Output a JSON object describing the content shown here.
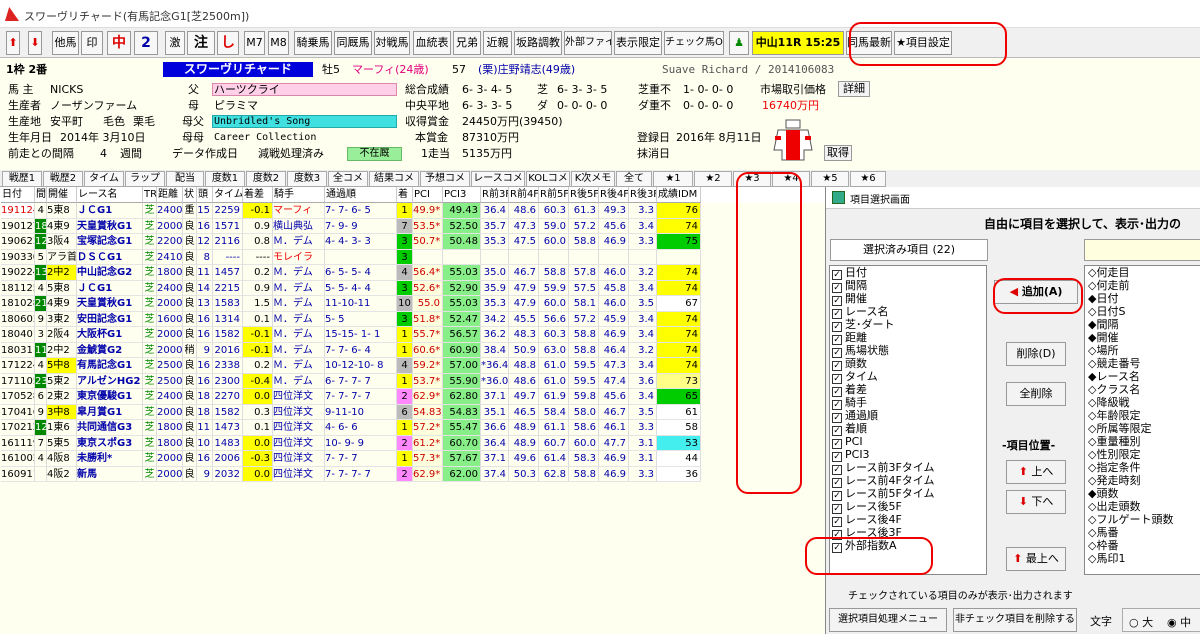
{
  "window": {
    "title": "スワーヴリチャード(有馬記念G1[芝2500m])"
  },
  "toolbar": {
    "buttons": [
      "他馬",
      "印",
      "中",
      "2",
      "激",
      "注",
      "し",
      "M7",
      "M8",
      "騎乗馬",
      "同厩馬",
      "対戦馬",
      "血統表",
      "兄弟",
      "近親",
      "坂路調教",
      "外部ファイル",
      "表示限定",
      "チェック馬OFF",
      "中山11R 15:25",
      "同馬最新",
      "★項目設定"
    ]
  },
  "horse": {
    "waku": "1枠 2番",
    "name": "スワーヴリチャード",
    "sex_age": "牡5",
    "jockey_prev": "マーフィ(24歳)",
    "weight": "57",
    "trainer": "(栗)庄野靖志(49歳)",
    "roman": "Suave Richard / 2014106083",
    "owner_label": "馬 主",
    "owner": "NICKS",
    "breeder_label": "生産者",
    "breeder": "ノーザンファーム",
    "origin_label": "生産地",
    "origin": "安平町",
    "coat_label": "毛色",
    "coat": "栗毛",
    "birth_label": "生年月日",
    "birth": "2014年 3月10日",
    "interval_label": "前走との間隔",
    "interval": "4",
    "interval_unit": "週間",
    "sire_label": "父",
    "sire": "ハーツクライ",
    "dam_label": "母",
    "dam": "ピラミマ",
    "bms_label": "母父",
    "bms": "Unbridled's Song",
    "damdam_label": "母母",
    "damdam": "Career Collection",
    "data_date_label": "データ作成日",
    "data_date": "減戦処理済み",
    "absent": "不在厩",
    "total_label": "総合成績",
    "total": "6- 3- 4- 5",
    "central_label": "中央平地",
    "central": "6- 3- 3- 5",
    "prize_label": "収得賞金",
    "prize": "24450万円(39450)",
    "main_prize_label": "本賞金",
    "main_prize": "87310万円",
    "per_race_label": "1走当",
    "per_race": "5135万円",
    "turf_label": "芝",
    "turf": "6- 3- 3- 5",
    "dirt_label": "ダ",
    "dirt": "0- 0- 0- 0",
    "turf_bad_label": "芝重不",
    "turf_bad": "1- 0- 0- 0",
    "dirt_bad_label": "ダ重不",
    "dirt_bad": "0- 0- 0- 0",
    "market_label": "市場取引価格",
    "market": "16740万円",
    "reg_label": "登録日",
    "reg": "2016年 8月11日",
    "erase_label": "抹消日",
    "detail_btn": "詳細",
    "get_btn": "取得"
  },
  "tabs": [
    "戦歴1",
    "戦歴2",
    "タイム",
    "ラップ",
    "配当",
    "度数1",
    "度数2",
    "度数3",
    "全コメ",
    "結果コメ",
    "予想コメ",
    "レースコメ",
    "KOLコメ",
    "K次メモ",
    "全て",
    "★1",
    "★2",
    "★3",
    "★4",
    "★5",
    "★6"
  ],
  "grid": {
    "headers": [
      "日付",
      "間",
      "開催",
      "レース名",
      "TR",
      "距離",
      "状",
      "頭",
      "タイム",
      "着差",
      "騎手",
      "通過順",
      "着",
      "PCI",
      "PCI3",
      "R前3F",
      "R前4F",
      "R前5F",
      "R後5F",
      "R後4F",
      "R後3F",
      "成績IDM"
    ],
    "rows": [
      [
        "191124",
        "4",
        "5東8",
        "ＪＣG1",
        "芝",
        "2400",
        "重",
        "15",
        "2259",
        "-0.1",
        "マーフィ",
        "7- 7- 6- 5",
        "1",
        "49.9*",
        "49.43",
        "36.4",
        "48.6",
        "60.3",
        "61.3",
        "49.3",
        "3.3",
        "76"
      ],
      [
        "190127",
        "18",
        "4東9",
        "天皇賞秋G1",
        "芝",
        "2000",
        "良",
        "16",
        "1571",
        "0.9",
        "横山典弘",
        "7- 9- 9",
        "7",
        "53.5*",
        "52.50",
        "35.7",
        "47.3",
        "59.0",
        "57.2",
        "45.6",
        "3.4",
        "74"
      ],
      [
        "190623",
        "12",
        "3阪4",
        "宝塚記念G1",
        "芝",
        "2200",
        "良",
        "12",
        "2116",
        "0.8",
        "Ｍ．デム",
        "4- 4- 3- 3",
        "3",
        "50.7*",
        "50.48",
        "35.3",
        "47.5",
        "60.0",
        "58.8",
        "46.9",
        "3.3",
        "75"
      ],
      [
        "190330",
        "5",
        "アラ首",
        "ＤＳＣG1",
        "芝",
        "2410",
        "良",
        "8",
        "----",
        "----",
        "モレイラ",
        "",
        "3",
        "",
        "",
        "",
        "",
        "",
        "",
        "",
        "",
        ""
      ],
      [
        "190224",
        "13",
        "2中2",
        "中山記念G2",
        "芝",
        "1800",
        "良",
        "11",
        "1457",
        "0.2",
        "Ｍ．デム",
        "6- 5- 5- 4",
        "4",
        "56.4*",
        "55.03",
        "35.0",
        "46.7",
        "58.8",
        "57.8",
        "46.0",
        "3.2",
        "74"
      ],
      [
        "181125",
        "4",
        "5東8",
        "ＪＣG1",
        "芝",
        "2400",
        "良",
        "14",
        "2215",
        "0.9",
        "Ｍ．デム",
        "5- 5- 4- 4",
        "3",
        "52.6*",
        "52.90",
        "35.9",
        "47.9",
        "59.9",
        "57.5",
        "45.8",
        "3.4",
        "74"
      ],
      [
        "181028",
        "21",
        "4東9",
        "天皇賞秋G1",
        "芝",
        "2000",
        "良",
        "13",
        "1583",
        "1.5",
        "Ｍ．デム",
        "11-10-11",
        "10",
        "55.0",
        "55.03",
        "35.3",
        "47.9",
        "60.0",
        "58.1",
        "46.0",
        "3.5",
        "67"
      ],
      [
        "180603",
        "9",
        "3東2",
        "安田記念G1",
        "芝",
        "1600",
        "良",
        "16",
        "1314",
        "0.1",
        "Ｍ．デム",
        "5- 5",
        "3",
        "51.8*",
        "52.47",
        "34.2",
        "45.5",
        "56.6",
        "57.2",
        "45.9",
        "3.4",
        "74"
      ],
      [
        "180401",
        "3",
        "2阪4",
        "大阪杯G1",
        "芝",
        "2000",
        "良",
        "16",
        "1582",
        "-0.1",
        "Ｍ．デム",
        "15-15- 1- 1",
        "1",
        "55.7*",
        "56.57",
        "36.2",
        "48.3",
        "60.3",
        "58.8",
        "46.9",
        "3.4",
        "74"
      ],
      [
        "180311",
        "11",
        "2中2",
        "金鯱賞G2",
        "芝",
        "2000",
        "稍",
        "9",
        "2016",
        "-0.1",
        "Ｍ．デム",
        "7- 7- 6- 4",
        "1",
        "60.6*",
        "60.90",
        "38.4",
        "50.9",
        "63.0",
        "58.8",
        "46.4",
        "3.2",
        "74"
      ],
      [
        "171224",
        "4",
        "5中8",
        "有馬記念G1",
        "芝",
        "2500",
        "良",
        "16",
        "2338",
        "0.2",
        "Ｍ．デム",
        "10-12-10- 8",
        "4",
        "59.2*",
        "57.00",
        "*36.4",
        "48.8",
        "61.0",
        "59.5",
        "47.3",
        "3.4",
        "74"
      ],
      [
        "171105",
        "23",
        "5東2",
        "アルゼンHG2",
        "芝",
        "2500",
        "良",
        "16",
        "2300",
        "-0.4",
        "Ｍ．デム",
        "6- 7- 7- 7",
        "1",
        "53.7*",
        "55.90",
        "*36.0",
        "48.6",
        "61.0",
        "59.5",
        "47.4",
        "3.6",
        "73"
      ],
      [
        "170528",
        "6",
        "2東2",
        "東京優駿G1",
        "芝",
        "2400",
        "良",
        "18",
        "2270",
        "0.0",
        "四位洋文",
        "7- 7- 7- 7",
        "2",
        "62.9*",
        "62.80",
        "37.1",
        "49.7",
        "61.9",
        "59.8",
        "45.6",
        "3.4",
        "65"
      ],
      [
        "170416",
        "9",
        "3中8",
        "皐月賞G1",
        "芝",
        "2000",
        "良",
        "18",
        "1582",
        "0.3",
        "四位洋文",
        "9-11-10",
        "6",
        "54.83",
        "54.83",
        "35.1",
        "46.5",
        "58.4",
        "58.0",
        "46.7",
        "3.5",
        "61"
      ],
      [
        "170212",
        "12",
        "1東6",
        "共同通信G3",
        "芝",
        "1800",
        "良",
        "11",
        "1473",
        "0.1",
        "四位洋文",
        "4- 6- 6",
        "1",
        "57.2*",
        "55.47",
        "36.6",
        "48.9",
        "61.1",
        "58.6",
        "46.1",
        "3.3",
        "58"
      ],
      [
        "161119",
        "7",
        "5東5",
        "東京スポG3",
        "芝",
        "1800",
        "良",
        "10",
        "1483",
        "0.0",
        "四位洋文",
        "10- 9- 9",
        "2",
        "61.2*",
        "60.70",
        "36.4",
        "48.9",
        "60.7",
        "60.0",
        "47.7",
        "3.1",
        "53"
      ],
      [
        "161002",
        "4",
        "4阪8",
        "未勝利*",
        "芝",
        "2000",
        "良",
        "16",
        "2006",
        "-0.3",
        "四位洋文",
        "7- 7- 7",
        "1",
        "57.3*",
        "57.67",
        "37.1",
        "49.6",
        "61.4",
        "58.3",
        "46.9",
        "3.1",
        "44"
      ],
      [
        "160911",
        "",
        "4阪2",
        "新馬",
        "芝",
        "2000",
        "良",
        "9",
        "2032",
        "0.0",
        "四位洋文",
        "7- 7- 7- 7",
        "2",
        "62.9*",
        "62.00",
        "37.4",
        "50.3",
        "62.8",
        "58.8",
        "46.9",
        "3.3",
        "36"
      ]
    ]
  },
  "dialog": {
    "title": "項目選択画面",
    "heading": "自由に項目を選択して、表示･出力の",
    "selected_label": "選択済み項目 (22)",
    "selected": [
      "日付",
      "間隔",
      "開催",
      "レース名",
      "芝･ダート",
      "距離",
      "馬場状態",
      "頭数",
      "タイム",
      "着差",
      "騎手",
      "通過順",
      "着順",
      "PCI",
      "PCI3",
      "レース前3Fタイム",
      "レース前4Fタイム",
      "レース前5Fタイム",
      "レース後5F",
      "レース後4F",
      "レース後3F",
      "外部指数A"
    ],
    "available": [
      "◇何走目",
      "◇何走前",
      "◆日付",
      "◇日付S",
      "◆間隔",
      "◆開催",
      "◇場所",
      "◇競走番号",
      "◆レース名",
      "◇クラス名",
      "◇降級戦",
      "◇年齢限定",
      "◇所属等限定",
      "◇重量種別",
      "◇性別限定",
      "◇指定条件",
      "◇発走時刻",
      "◆頭数",
      "◇出走頭数",
      "◇フルゲート頭数",
      "◇馬番",
      "◇枠番",
      "◇馬印1"
    ],
    "add_btn": "追加(A)",
    "del_btn": "削除(D)",
    "del_all_btn": "全削除",
    "pos_label": "-項目位置-",
    "up_btn": "上へ",
    "down_btn": "下へ",
    "top_btn": "最上へ",
    "note": "チェックされている項目のみが表示･出力されます",
    "menu_btn": "選択項目処理メニュー",
    "uncheck_btn": "非チェック項目を削除する",
    "font_label": "文字",
    "radio_big": "大",
    "radio_mid": "中"
  }
}
